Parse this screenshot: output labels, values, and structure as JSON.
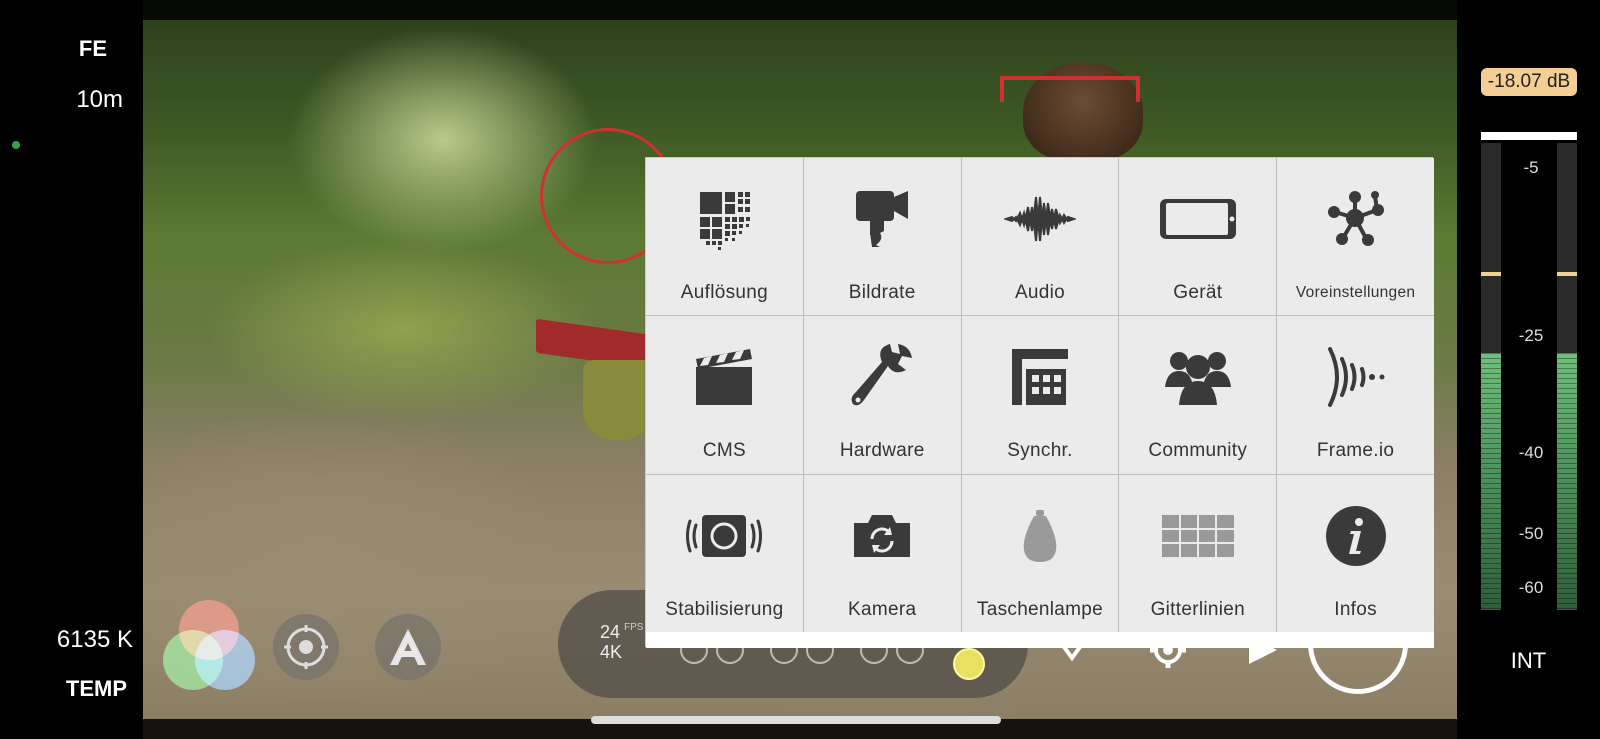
{
  "left_bar": {
    "focus_mode": "FE",
    "focus_distance": "10m",
    "white_balance_value": "6135 K",
    "white_balance_label": "TEMP"
  },
  "record_pill": {
    "frame_rate": "24",
    "fps_unit": "FPS",
    "resolution": "4K"
  },
  "menu": {
    "items": [
      {
        "label": "Auflösung",
        "icon": "resolution-icon"
      },
      {
        "label": "Bildrate",
        "icon": "camera-icon"
      },
      {
        "label": "Audio",
        "icon": "audio-waveform-icon"
      },
      {
        "label": "Gerät",
        "icon": "device-icon"
      },
      {
        "label": "Voreinstellungen",
        "icon": "presets-icon"
      },
      {
        "label": "CMS",
        "icon": "clapperboard-icon"
      },
      {
        "label": "Hardware",
        "icon": "wrench-icon"
      },
      {
        "label": "Synchr.",
        "icon": "sync-icon"
      },
      {
        "label": "Community",
        "icon": "community-icon"
      },
      {
        "label": "Frame.io",
        "icon": "frameio-icon"
      },
      {
        "label": "Stabilisierung",
        "icon": "stabilization-icon"
      },
      {
        "label": "Kamera",
        "icon": "camera-switch-icon"
      },
      {
        "label": "Taschenlampe",
        "icon": "flashlight-icon"
      },
      {
        "label": "Gitterlinien",
        "icon": "grid-icon"
      },
      {
        "label": "Infos",
        "icon": "info-icon"
      }
    ]
  },
  "audio_meter": {
    "level": "-18.07 dB",
    "ticks": [
      "-5",
      "-25",
      "-40",
      "-50",
      "-60"
    ],
    "input": "INT",
    "fill_fraction": 0.55,
    "peak_color": "#f3cf94"
  },
  "colors": {
    "focus_circle": "#d03030",
    "menu_background": "#ebebeb",
    "record_ring": "#ffffff"
  }
}
